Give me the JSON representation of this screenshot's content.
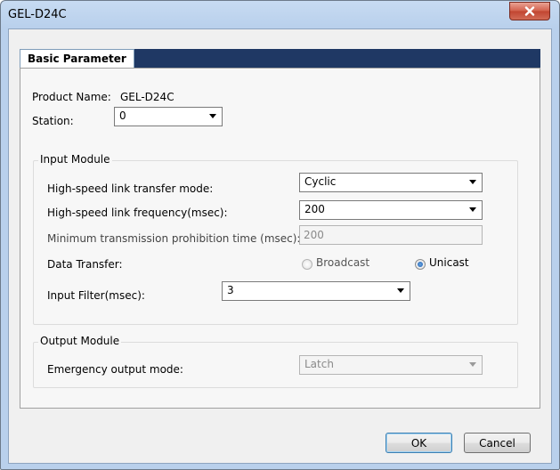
{
  "window": {
    "title": "GEL-D24C",
    "close_icon": "close-icon"
  },
  "tabs": [
    {
      "label": "Basic Parameter",
      "selected": true
    }
  ],
  "product": {
    "label": "Product Name:",
    "value": "GEL-D24C"
  },
  "station": {
    "label": "Station:",
    "value": "0"
  },
  "input_module": {
    "title": "Input Module",
    "hs_mode": {
      "label": "High-speed link transfer mode:",
      "value": "Cyclic"
    },
    "hs_freq": {
      "label": "High-speed link frequency(msec):",
      "value": "200"
    },
    "min_trans": {
      "label": "Minimum transmission prohibition time (msec):",
      "value": "200",
      "disabled": true
    },
    "data_transfer": {
      "label": "Data Transfer:",
      "options": [
        "Broadcast",
        "Unicast"
      ],
      "selected": "Unicast",
      "broadcast_disabled": true
    },
    "input_filter": {
      "label": "Input Filter(msec):",
      "value": "3"
    }
  },
  "output_module": {
    "title": "Output Module",
    "emergency": {
      "label": "Emergency output mode:",
      "value": "Latch",
      "disabled": true
    }
  },
  "buttons": {
    "ok": "OK",
    "cancel": "Cancel"
  },
  "colors": {
    "tab_strip": "#1f3864",
    "title_gradient": "#c7dbf2",
    "close_button": "#c04531"
  }
}
